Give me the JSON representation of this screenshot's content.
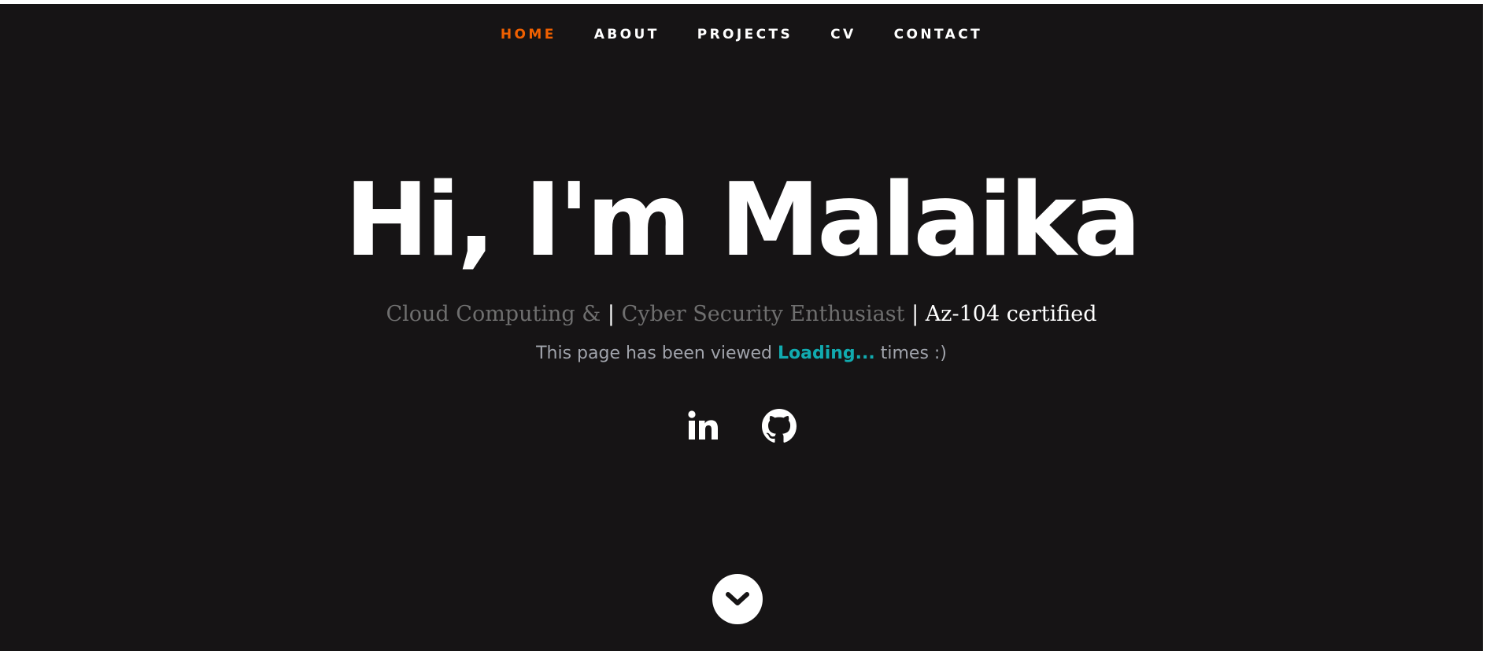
{
  "nav": {
    "items": [
      {
        "label": "HOME",
        "current": true
      },
      {
        "label": "ABOUT"
      },
      {
        "label": "PROJECTS"
      },
      {
        "label": "CV"
      },
      {
        "label": "CONTACT"
      }
    ],
    "active_color": "#f06000"
  },
  "hero": {
    "headline": "Hi, I'm Malaika",
    "tagline": {
      "part1": "Cloud Computing &",
      "separator1": "|",
      "part2": "Cyber Security Enthusiast",
      "separator2": "|",
      "part3": "Az-104 certified"
    },
    "counter": {
      "prefix": "This page has been viewed",
      "value": "Loading...",
      "suffix": "times :)"
    }
  },
  "social": [
    {
      "icon": "linkedin-icon"
    },
    {
      "icon": "github-icon"
    }
  ],
  "scroll_down": {
    "icon": "chevron-down-icon"
  },
  "colors": {
    "background": "#161415",
    "accent": "#11abb0",
    "text": "#ffffff",
    "muted": "#6f6f6f"
  }
}
